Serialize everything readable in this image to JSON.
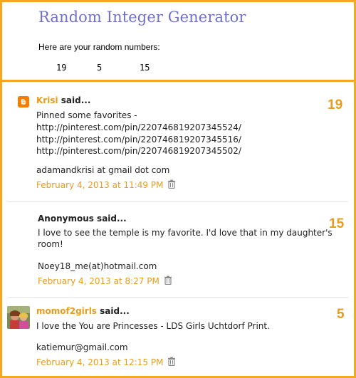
{
  "generator": {
    "title": "Random Integer Generator",
    "subtitle": "Here are your random numbers:",
    "numbers": [
      "19",
      "5",
      "15"
    ]
  },
  "comments": [
    {
      "author": "Krisi",
      "said": " said...",
      "lines": [
        "Pinned some favorites -",
        "http://pinterest.com/pin/220746819207345524/",
        "http://pinterest.com/pin/220746819207345516/",
        "http://pinterest.com/pin/220746819207345502/",
        "",
        "adamandkrisi at gmail dot com"
      ],
      "timestamp": "February 4, 2013 at 11:49 PM",
      "number": "19",
      "icon": "blogger-icon"
    },
    {
      "author": "Anonymous",
      "said": " said...",
      "lines": [
        "I love to see the temple is my favorite. I'd love that in my daughter's",
        "room!",
        "",
        "Noey18_me(at)hotmail.com"
      ],
      "timestamp": "February 4, 2013 at 8:27 PM",
      "number": "15"
    },
    {
      "author": "momof2girls",
      "said": " said...",
      "lines": [
        "I love the You are Princesses - LDS Girls Uchtdorf Print.",
        "",
        "katiemur@gmail.com"
      ],
      "timestamp": "February 4, 2013 at 12:15 PM",
      "number": "5",
      "icon": "avatar-photo"
    }
  ],
  "colors": {
    "accent": "#f2a91f",
    "title": "#7070c8",
    "link": "#e69c1e"
  }
}
